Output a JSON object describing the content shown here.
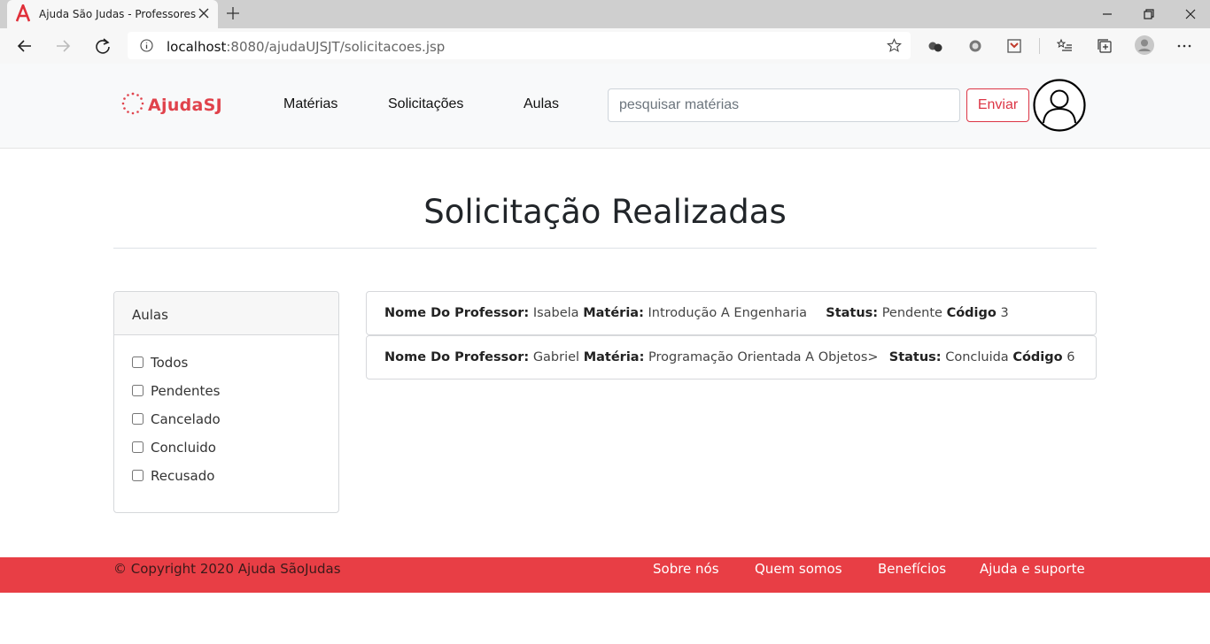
{
  "browser": {
    "tab_title": "Ajuda São Judas - Professores",
    "url_host": "localhost",
    "url_rest": ":8080/ajudaUJSJT/solicitacoes.jsp"
  },
  "header": {
    "brand": "AjudaSJ",
    "nav": [
      "Matérias",
      "Solicitações",
      "Aulas"
    ],
    "search_placeholder": "pesquisar matérias",
    "send_label": "Enviar"
  },
  "main": {
    "title": "Solicitação Realizadas",
    "filter": {
      "heading": "Aulas",
      "options": [
        "Todos",
        "Pendentes",
        "Cancelado",
        "Concluido",
        "Recusado"
      ]
    },
    "labels": {
      "professor": "Nome Do Professor:",
      "subject": "Matéria:",
      "status": "Status:",
      "code": "Código"
    },
    "requests": [
      {
        "professor": "Isabela",
        "subject": "Introdução A Engenharia",
        "status": "Pendente",
        "code": "3"
      },
      {
        "professor": "Gabriel",
        "subject": "Programação Orientada A Objetos>",
        "status": "Concluida",
        "code": "6"
      }
    ]
  },
  "footer": {
    "copyright": "© Copyright 2020 Ajuda SãoJudas",
    "links": [
      "Sobre nós",
      "Quem somos",
      "Benefícios",
      "Ajuda e suporte"
    ]
  },
  "colors": {
    "brand_red": "#e0424b",
    "footer_red": "#e83e45",
    "button_red": "#dc3545"
  }
}
